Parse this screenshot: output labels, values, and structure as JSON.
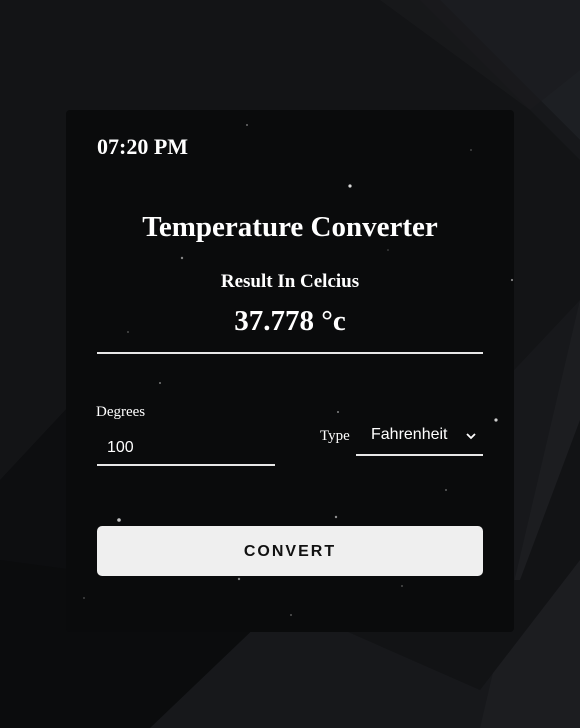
{
  "clock": {
    "time": "07:20 PM"
  },
  "converter": {
    "title": "Temperature Converter",
    "result_label": "Result In Celcius",
    "result_value": "37.778 °c",
    "degrees_label": "Degrees",
    "degrees_value": "100",
    "type_label": "Type",
    "type_selected": "Fahrenheit",
    "convert_label": "CONVERT"
  },
  "icons": {
    "type_dropdown": "chevron-down-icon"
  },
  "colors": {
    "page_background": "#131416",
    "card_background": "#0a0b0c",
    "text": "#ffffff",
    "button_background": "#efefef",
    "button_text": "#111111"
  }
}
